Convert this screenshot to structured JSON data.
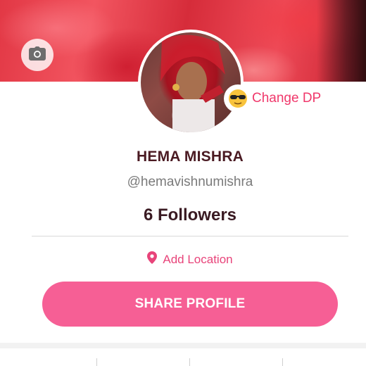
{
  "cover": {
    "description_icon": "camera-icon"
  },
  "profile": {
    "change_dp_label": "Change DP",
    "change_dp_emoji": "😎",
    "name": "HEMA MISHRA",
    "handle": "@hemavishnumishra",
    "followers": "6 Followers",
    "location_label": "Add Location"
  },
  "actions": {
    "share_label": "SHARE PROFILE"
  },
  "colors": {
    "accent": "#f65f95",
    "accent_text": "#f0386b",
    "name_text": "#4a1a22"
  }
}
